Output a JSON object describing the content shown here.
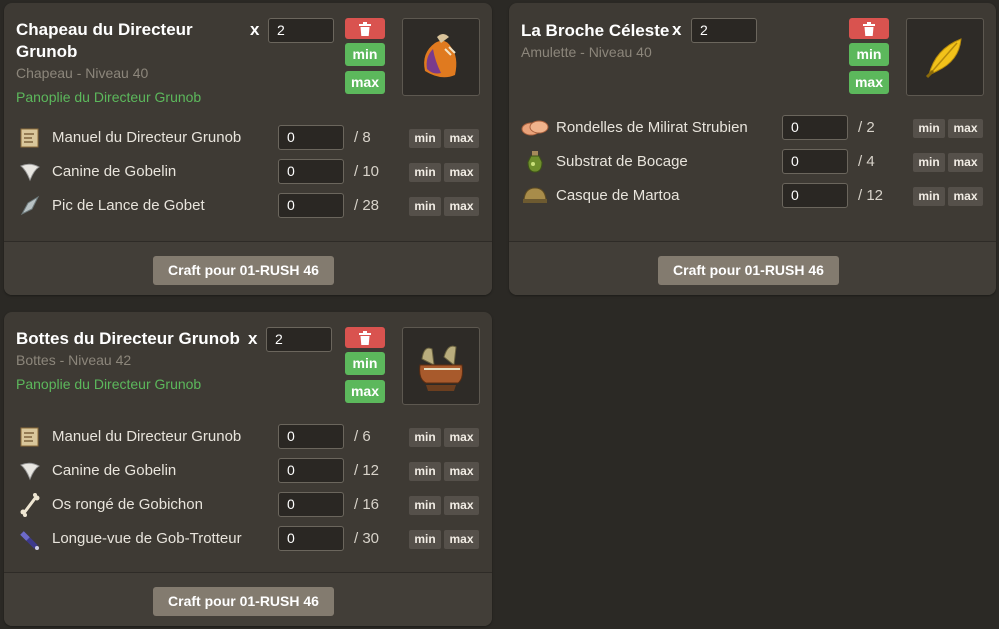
{
  "cards": [
    {
      "title_line1": "Chapeau du Directeur",
      "title_line2": "Grunob",
      "qty_x": "x",
      "qty_value": "2",
      "subtitle": "Chapeau - Niveau 40",
      "panoplie": "Panoplie du Directeur Grunob",
      "min_label": "min",
      "max_label": "max",
      "item_icon": "orange-hat-icon",
      "resources": [
        {
          "name": "Manuel du Directeur Grunob",
          "value": "0",
          "total": "/ 8",
          "icon": "scroll-icon"
        },
        {
          "name": "Canine de Gobelin",
          "value": "0",
          "total": "/ 10",
          "icon": "fang-icon"
        },
        {
          "name": "Pic de Lance de Gobet",
          "value": "0",
          "total": "/ 28",
          "icon": "spear-tip-icon"
        }
      ],
      "res_min": "min",
      "res_max": "max",
      "craft_label": "Craft pour 01-RUSH 46"
    },
    {
      "title_line1": "La Broche Céleste",
      "qty_x": "x",
      "qty_value": "2",
      "subtitle": "Amulette - Niveau 40",
      "min_label": "min",
      "max_label": "max",
      "item_icon": "golden-feather-icon",
      "resources": [
        {
          "name": "Rondelles de Milirat Strubien",
          "value": "0",
          "total": "/ 2",
          "icon": "meat-slices-icon"
        },
        {
          "name": "Substrat de Bocage",
          "value": "0",
          "total": "/ 4",
          "icon": "potion-bottle-icon"
        },
        {
          "name": "Casque de Martoa",
          "value": "0",
          "total": "/ 12",
          "icon": "helmet-icon"
        }
      ],
      "res_min": "min",
      "res_max": "max",
      "craft_label": "Craft pour 01-RUSH 46"
    },
    {
      "title_line1": "Bottes du Directeur Grunob",
      "qty_x": "x",
      "qty_value": "2",
      "subtitle": "Bottes - Niveau 42",
      "panoplie": "Panoplie du Directeur Grunob",
      "min_label": "min",
      "max_label": "max",
      "item_icon": "boots-icon",
      "resources": [
        {
          "name": "Manuel du Directeur Grunob",
          "value": "0",
          "total": "/ 6",
          "icon": "scroll-icon"
        },
        {
          "name": "Canine de Gobelin",
          "value": "0",
          "total": "/ 12",
          "icon": "fang-icon"
        },
        {
          "name": "Os rongé de Gobichon",
          "value": "0",
          "total": "/ 16",
          "icon": "bone-icon"
        },
        {
          "name": "Longue-vue de Gob-Trotteur",
          "value": "0",
          "total": "/ 30",
          "icon": "spyglass-icon"
        }
      ],
      "res_min": "min",
      "res_max": "max",
      "craft_label": "Craft pour 01-RUSH 46"
    }
  ],
  "colors": {
    "background": "#2b2925",
    "card": "#3e3a34",
    "accent_green": "#5cb85c",
    "danger_red": "#d9534f",
    "muted_text": "#8c867b"
  }
}
